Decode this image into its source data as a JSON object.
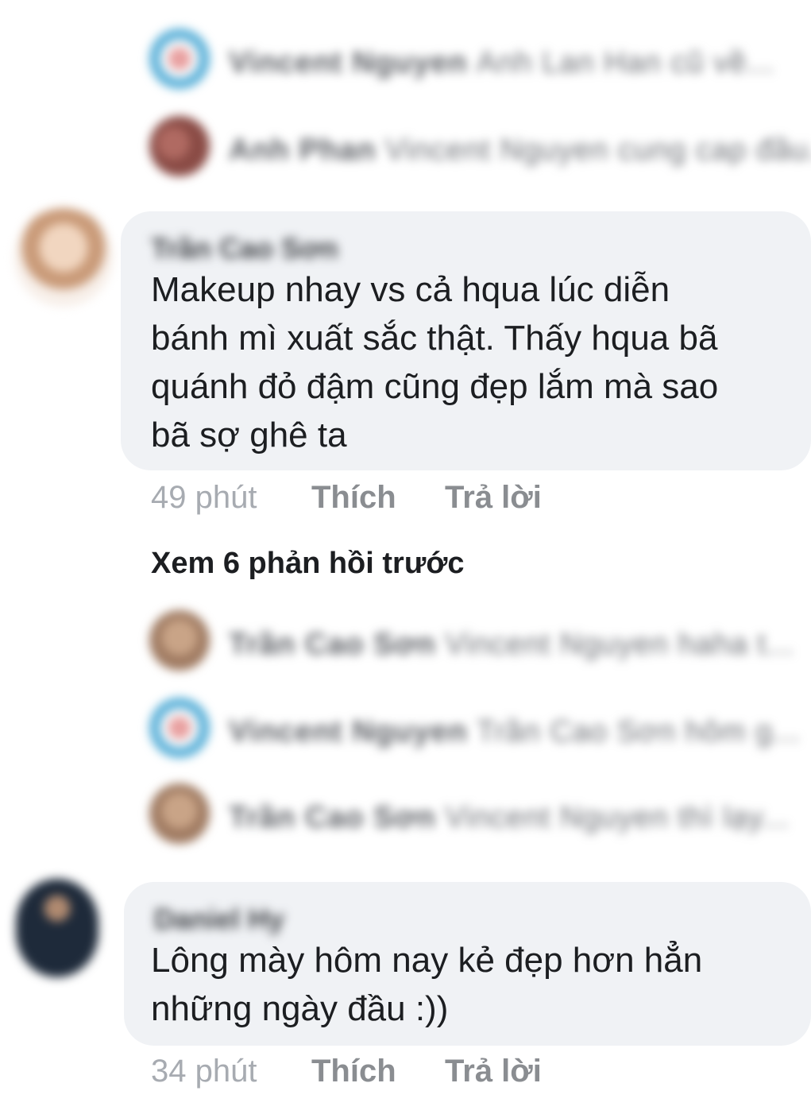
{
  "top_replies": [
    {
      "author": "Vincent Nguyen",
      "snippet": "Anh Lan Han cũ về...",
      "avatar_icon": "badge-avatar-icon"
    },
    {
      "author": "Anh Phan",
      "snippet": "Vincent Nguyen cung cap đầu...",
      "avatar_icon": "user-avatar-icon"
    }
  ],
  "comments": [
    {
      "author": "Trần Cao Sơn",
      "lines": [
        "Makeup nhay vs cả hqua lúc diễn",
        "bánh mì xuất sắc thật. Thấy hqua bã",
        "quánh đỏ đậm cũng đẹp lắm mà sao",
        "bã sợ ghê ta"
      ],
      "time": "49 phút",
      "like": "Thích",
      "reply": "Trả lời"
    },
    {
      "author": "Daniel Hy",
      "lines": [
        "Lông mày hôm nay kẻ đẹp hơn hẳn",
        "những ngày đầu :))"
      ],
      "time": "34 phút",
      "like": "Thích",
      "reply": "Trả lời"
    }
  ],
  "view_previous": "Xem 6 phản hồi trước",
  "mid_replies": [
    {
      "author": "Trần Cao Sơn",
      "snippet": "Vincent Nguyen haha t...",
      "avatar_icon": "user-avatar-icon"
    },
    {
      "author": "Vincent Nguyen",
      "snippet": "Trần Cao Sơn hôm g...",
      "avatar_icon": "badge-avatar-icon"
    },
    {
      "author": "Trần Cao Sơn",
      "snippet": "Vincent Nguyen thì lạy...",
      "avatar_icon": "user-avatar-icon"
    }
  ],
  "colors": {
    "bubble_bg": "#f0f2f5",
    "action_text": "#8a8d91",
    "time_text": "#a7abb1"
  }
}
